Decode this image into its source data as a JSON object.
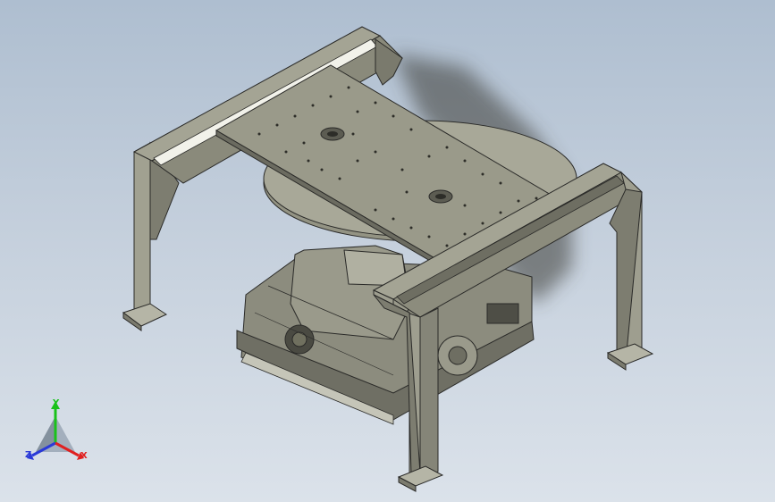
{
  "viewport": {
    "background_top": "#aebed0",
    "background_bottom": "#dbe2ea"
  },
  "model": {
    "frame_color": "#8f8f80",
    "frame_dark": "#6d6d60",
    "plate_color": "#939383",
    "robot_color": "#8a8a7c",
    "line_color": "#2a2a28"
  },
  "triad": {
    "axes": [
      {
        "name": "y",
        "label": "Y",
        "color": "#19c219"
      },
      {
        "name": "z",
        "label": "Z",
        "color": "#2a3ad8"
      },
      {
        "name": "x",
        "label": "X",
        "color": "#e02020"
      }
    ]
  }
}
